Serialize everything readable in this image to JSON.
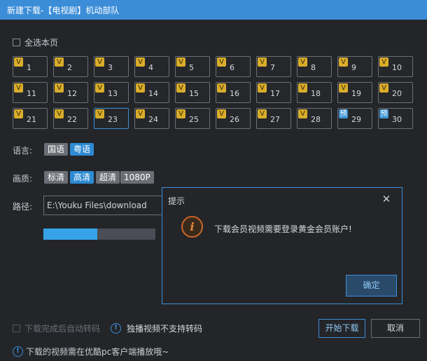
{
  "window": {
    "title": "新建下载-【电视剧】机动部队"
  },
  "select_all": {
    "label": "全选本页",
    "checked": false
  },
  "episodes": [
    {
      "num": "1",
      "tag": "V",
      "tag_type": "vip"
    },
    {
      "num": "2",
      "tag": "V",
      "tag_type": "vip"
    },
    {
      "num": "3",
      "tag": "V",
      "tag_type": "vip"
    },
    {
      "num": "4",
      "tag": "V",
      "tag_type": "vip"
    },
    {
      "num": "5",
      "tag": "V",
      "tag_type": "vip"
    },
    {
      "num": "6",
      "tag": "V",
      "tag_type": "vip"
    },
    {
      "num": "7",
      "tag": "V",
      "tag_type": "vip"
    },
    {
      "num": "8",
      "tag": "V",
      "tag_type": "vip"
    },
    {
      "num": "9",
      "tag": "V",
      "tag_type": "vip"
    },
    {
      "num": "10",
      "tag": "V",
      "tag_type": "vip"
    },
    {
      "num": "11",
      "tag": "V",
      "tag_type": "vip"
    },
    {
      "num": "12",
      "tag": "V",
      "tag_type": "vip"
    },
    {
      "num": "13",
      "tag": "V",
      "tag_type": "vip"
    },
    {
      "num": "14",
      "tag": "V",
      "tag_type": "vip"
    },
    {
      "num": "15",
      "tag": "V",
      "tag_type": "vip"
    },
    {
      "num": "16",
      "tag": "V",
      "tag_type": "vip"
    },
    {
      "num": "17",
      "tag": "V",
      "tag_type": "vip"
    },
    {
      "num": "18",
      "tag": "V",
      "tag_type": "vip"
    },
    {
      "num": "19",
      "tag": "V",
      "tag_type": "vip"
    },
    {
      "num": "20",
      "tag": "V",
      "tag_type": "vip"
    },
    {
      "num": "21",
      "tag": "V",
      "tag_type": "vip"
    },
    {
      "num": "22",
      "tag": "V",
      "tag_type": "vip"
    },
    {
      "num": "23",
      "tag": "V",
      "tag_type": "vip",
      "selected": true
    },
    {
      "num": "24",
      "tag": "V",
      "tag_type": "vip"
    },
    {
      "num": "25",
      "tag": "V",
      "tag_type": "vip"
    },
    {
      "num": "26",
      "tag": "V",
      "tag_type": "vip"
    },
    {
      "num": "27",
      "tag": "V",
      "tag_type": "vip"
    },
    {
      "num": "28",
      "tag": "V",
      "tag_type": "vip"
    },
    {
      "num": "29",
      "tag": "预",
      "tag_type": "pre"
    },
    {
      "num": "30",
      "tag": "预",
      "tag_type": "pre"
    }
  ],
  "language": {
    "label": "语言:",
    "options": [
      "国语",
      "粤语"
    ],
    "active": "粤语"
  },
  "quality": {
    "label": "画质:",
    "options": [
      "标清",
      "高清",
      "超清",
      "1080P"
    ],
    "active": "高清"
  },
  "path": {
    "label": "路径:",
    "value": "E:\\Youku Files\\download"
  },
  "progress": {
    "fraction": 0.48
  },
  "dialog": {
    "title": "提示",
    "message": "下载会员视频需要登录黄金会员账户!",
    "ok_label": "确定"
  },
  "options": {
    "transcode_label": "下载完成后自动转码",
    "exclusive_notice": "独播视频不支持转码"
  },
  "buttons": {
    "start": "开始下载",
    "cancel": "取消"
  },
  "footer": {
    "notice": "下载的视频需在优酷pc客户端播放哦~"
  },
  "colors": {
    "accent": "#3c8dd8",
    "vip_tag": "#d9ad2b",
    "progress": "#36a3e8"
  }
}
